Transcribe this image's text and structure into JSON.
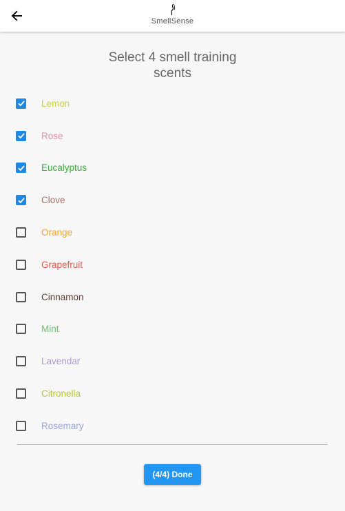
{
  "appbar": {
    "back_icon": "arrow-left-icon",
    "logo_icon": "smell-wisp-icon",
    "logo_text": "SmellSense"
  },
  "title": {
    "line1": "Select 4 smell training",
    "line2": "scents"
  },
  "accent_color": "#1e88e5",
  "scents": [
    {
      "label": "Lemon",
      "checked": true,
      "color": "#c6d34a"
    },
    {
      "label": "Rose",
      "checked": true,
      "color": "#f08aa8"
    },
    {
      "label": "Eucalyptus",
      "checked": true,
      "color": "#3aaa3a"
    },
    {
      "label": "Clove",
      "checked": true,
      "color": "#a5726a"
    },
    {
      "label": "Orange",
      "checked": false,
      "color": "#f5a623"
    },
    {
      "label": "Grapefruit",
      "checked": false,
      "color": "#e55a4e"
    },
    {
      "label": "Cinnamon",
      "checked": false,
      "color": "#5a3b33"
    },
    {
      "label": "Mint",
      "checked": false,
      "color": "#6fc07a"
    },
    {
      "label": "Lavendar",
      "checked": false,
      "color": "#ad9bd1"
    },
    {
      "label": "Citronella",
      "checked": false,
      "color": "#b5c92e"
    },
    {
      "label": "Rosemary",
      "checked": false,
      "color": "#9aa3d8"
    }
  ],
  "done_button": {
    "label": "(4/4) Done",
    "color": "#2196f3"
  }
}
